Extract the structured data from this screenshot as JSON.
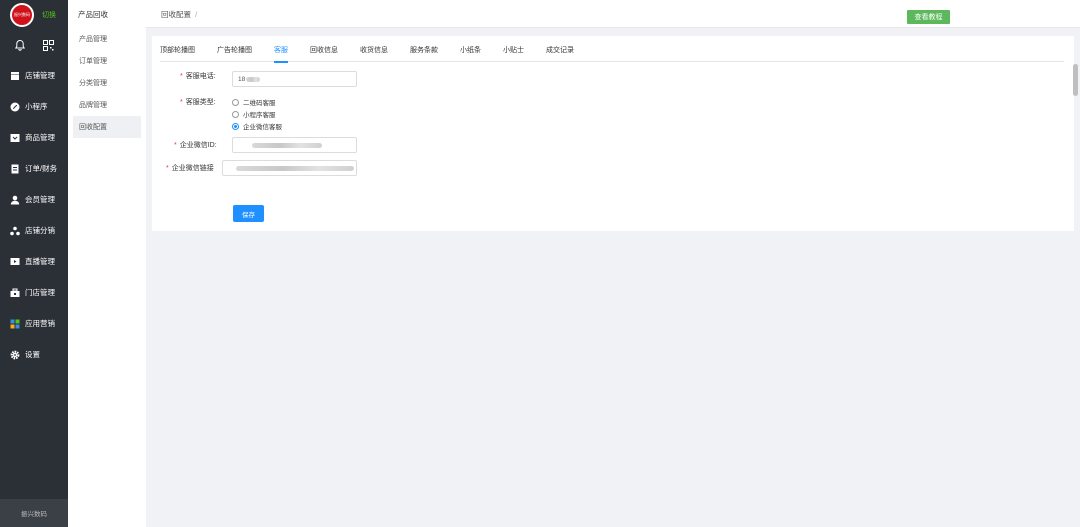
{
  "sidebar": {
    "logo_text": "振兴数码",
    "switch_label": "切换",
    "items": [
      {
        "label": "店铺管理",
        "icon": "store-icon"
      },
      {
        "label": "小程序",
        "icon": "miniprogram-icon"
      },
      {
        "label": "商品管理",
        "icon": "goods-icon"
      },
      {
        "label": "订单/财务",
        "icon": "order-icon"
      },
      {
        "label": "会员管理",
        "icon": "member-icon"
      },
      {
        "label": "店铺分销",
        "icon": "distribution-icon"
      },
      {
        "label": "直播管理",
        "icon": "live-icon"
      },
      {
        "label": "门店管理",
        "icon": "shop-icon"
      },
      {
        "label": "应用营销",
        "icon": "apps-icon"
      },
      {
        "label": "设置",
        "icon": "gear-icon"
      }
    ],
    "bottom_label": "振兴数码"
  },
  "subnav": {
    "title": "产品回收",
    "items": [
      "产品管理",
      "订单管理",
      "分类管理",
      "品牌管理",
      "回收配置"
    ],
    "active_index": 4
  },
  "topbar": {
    "breadcrumb": "回收配置",
    "breadcrumb_sep": "/",
    "tutorial_button": "查看教程"
  },
  "tabs": [
    "顶部轮播图",
    "广告轮播图",
    "客服",
    "回收信息",
    "收货信息",
    "服务条款",
    "小纸条",
    "小贴士",
    "成交记录"
  ],
  "active_tab": 2,
  "form": {
    "phone_label": "客服电话:",
    "phone_value": "18",
    "type_label": "客服类型:",
    "type_options": [
      "二维码客服",
      "小程序客服",
      "企业微信客服"
    ],
    "type_selected": 2,
    "wecom_id_label": "企业微信ID:",
    "wecom_link_label": "企业微信链接",
    "save_button": "保存"
  },
  "colors": {
    "sidebar_bg": "#2b2f36",
    "accent_blue": "#1e90ff",
    "tutorial_green": "#5cb85c",
    "logo_red": "#d0121b",
    "required_red": "#e53935"
  }
}
